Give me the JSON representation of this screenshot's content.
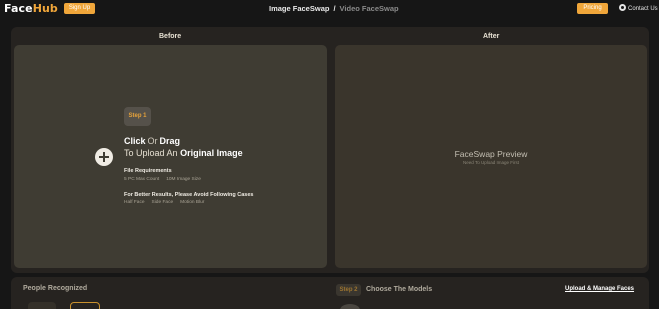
{
  "header": {
    "logo_face": "Face",
    "logo_hub": "Hub",
    "signup_label": "Sign Up",
    "mode_active": "Image FaceSwap",
    "mode_separator": "/",
    "mode_inactive": "Video FaceSwap",
    "pricing_label": "Pricing",
    "contact_label": "Contact Us"
  },
  "columns": {
    "before": "Before",
    "after": "After"
  },
  "upload": {
    "step_label": "Step 1",
    "click": "Click",
    "or": "Or",
    "drag": "Drag",
    "to_upload": "To Upload An",
    "original_image": "Original Image",
    "requirements_title": "File Requirements",
    "requirements": [
      "5 PC Max Count",
      "10M Image Size"
    ],
    "avoid_title": "For Better Results, Please Avoid Following Cases",
    "avoid": [
      "Half Face",
      "Side Face",
      "Motion Blur"
    ]
  },
  "preview": {
    "title": "FaceSwap Preview",
    "subtitle": "Need To Upload Image First"
  },
  "bottom": {
    "people_title": "People Recognized",
    "step_label": "Step 2",
    "choose_title": "Choose The Models",
    "manage_label": "Upload & Manage Faces"
  },
  "colors": {
    "accent": "#f0a63a",
    "background": "#161616",
    "panel": "#262320",
    "upload_area": "#3f3c33",
    "preview_area": "#3a352c"
  },
  "icons": {
    "upload": "plus-circle-icon",
    "contact": "chat-icon"
  }
}
